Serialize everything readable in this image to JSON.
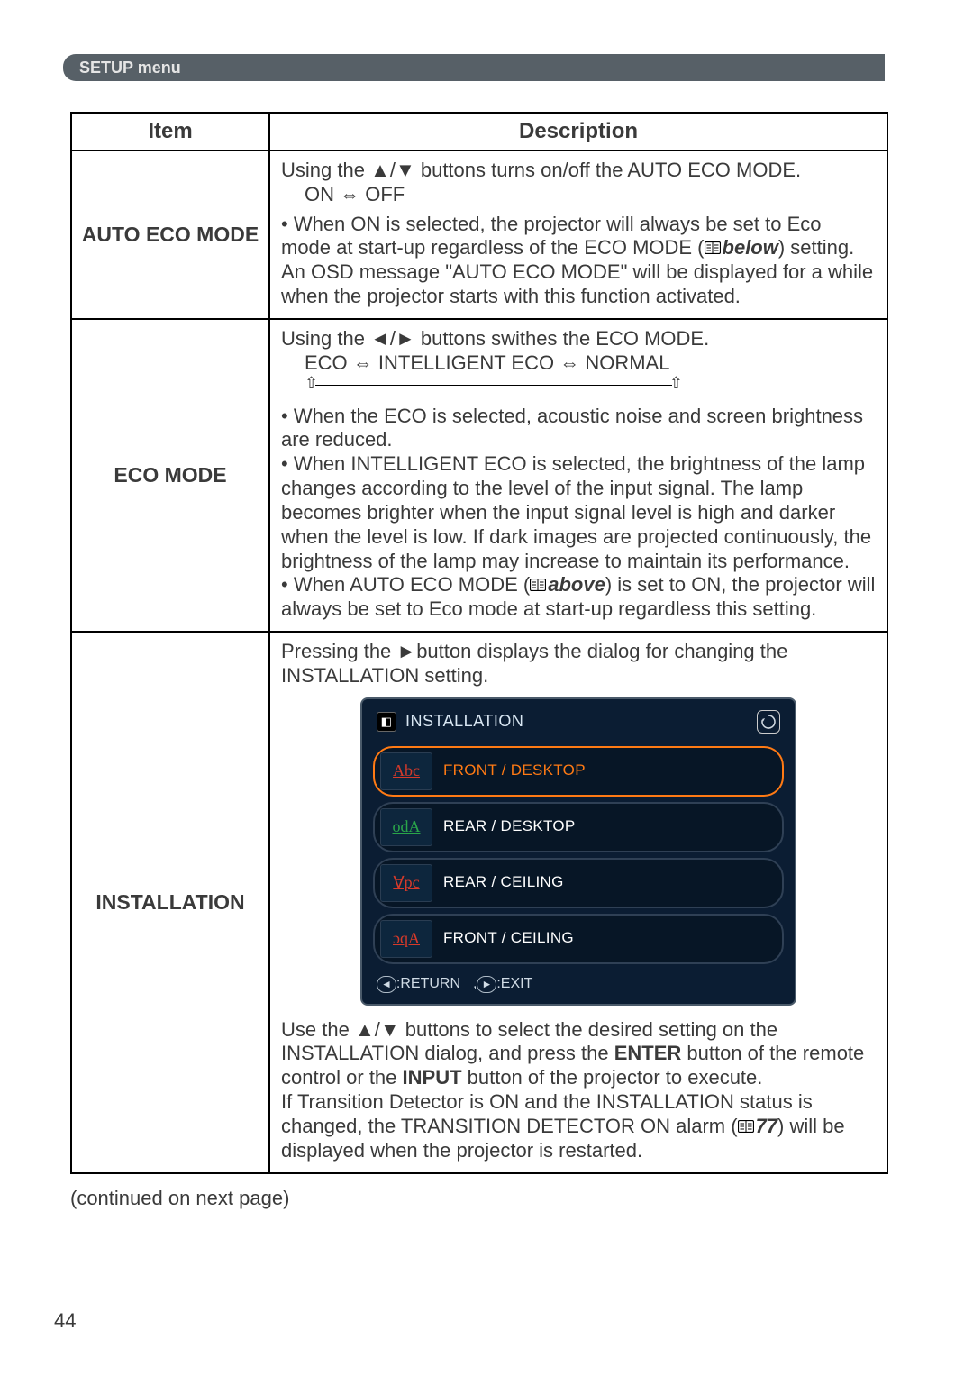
{
  "banner": {
    "title": "SETUP menu"
  },
  "table": {
    "headers": {
      "item": "Item",
      "description": "Description"
    },
    "rows": {
      "autoEco": {
        "item": "AUTO ECO MODE",
        "line1_pre": "Using the ",
        "line1_btns": "▲/▼",
        "line1_post": " buttons turns on/off the AUTO ECO MODE.",
        "cycle": "ON ⇔ OFF",
        "bullet_pre": "• When ON is selected, the projector will always be set to Eco mode at start-up regardless of the ECO MODE (",
        "bullet_ref": "below",
        "bullet_post": ") setting. An OSD message \"AUTO ECO MODE\" will be displayed for a while when the projector starts with this function activated."
      },
      "ecoMode": {
        "item": "ECO MODE",
        "line1_pre": "Using the ",
        "line1_btns": "◄/►",
        "line1_post": " buttons swithes the ECO MODE.",
        "cycle": "ECO ⇔ INTELLIGENT ECO ⇔ NORMAL",
        "b1": "• When the ECO is selected, acoustic noise and screen brightness are reduced.",
        "b2": "• When INTELLIGENT ECO is selected, the brightness of the lamp changes according to the level of the input signal. The lamp becomes brighter when the input signal level is high and darker when the level is low. If dark images are projected continuously, the brightness of the lamp may increase to maintain its performance.",
        "b3_pre": "• When AUTO ECO MODE (",
        "b3_ref": "above",
        "b3_post": ") is set to ON, the projector will always be set to Eco mode at start-up regardless this setting."
      },
      "installation": {
        "item": "INSTALLATION",
        "intro_pre": "Pressing the ",
        "intro_btn": "►",
        "intro_post": "button displays the dialog for changing the INSTALLATION setting.",
        "osd": {
          "title": "INSTALLATION",
          "options": [
            {
              "label": "FRONT / DESKTOP",
              "thumb": "Abc",
              "selected": true,
              "flipH": false,
              "flipV": false
            },
            {
              "label": "REAR / DESKTOP",
              "thumb": "odA",
              "selected": false,
              "flipH": false,
              "flipV": false
            },
            {
              "label": "REAR / CEILING",
              "thumb": "∀pc",
              "selected": false,
              "flipH": false,
              "flipV": false
            },
            {
              "label": "FRONT / CEILING",
              "thumb": "ɔqA",
              "selected": false,
              "flipH": false,
              "flipV": false
            }
          ],
          "footer": {
            "return_key": "◄",
            "return_txt": ":RETURN",
            "exit_sep": ",",
            "exit_key": "►",
            "exit_txt": ":EXIT"
          }
        },
        "after1_pre": "Use the ",
        "after1_btns": "▲/▼",
        "after1_post": " buttons to select the desired setting on the INSTALLATION dialog, and press the ",
        "enter": "ENTER",
        "after1_post2": " button of the remote control or the ",
        "input": "INPUT",
        "after1_post3": " button of the projector to execute.",
        "after2_pre": "If Transition Detector is ON and the INSTALLATION status is changed, the TRANSITION DETECTOR ON alarm (",
        "after2_ref": "77",
        "after2_post": ") will be displayed when the projector is restarted."
      }
    }
  },
  "continued": "(continued on next page)",
  "pageNumber": "44"
}
